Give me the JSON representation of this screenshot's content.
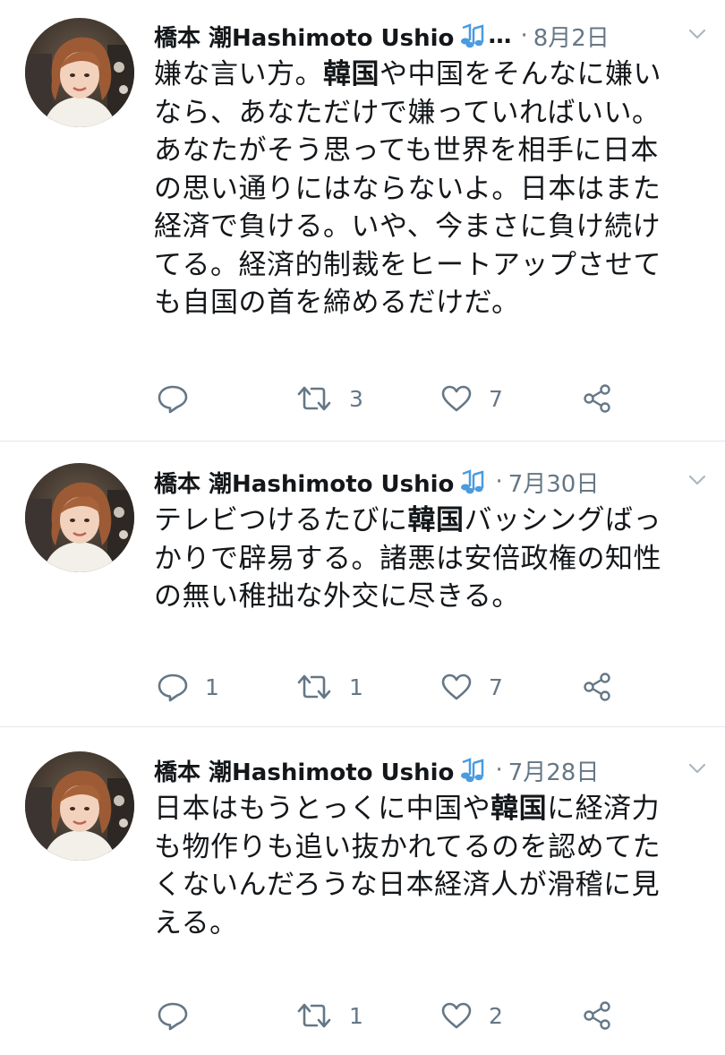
{
  "tweets": [
    {
      "author": "橋本 潮Hashimoto Ushio",
      "truncation": "…",
      "separator": "·",
      "date": "8月2日",
      "text_segments": [
        {
          "t": "嫌な言い方。",
          "bold": false
        },
        {
          "t": "韓国",
          "bold": true
        },
        {
          "t": "や中国をそんなに嫌いなら、あなただけで嫌っていればいい。あなたがそう思っても世界を相手に日本の思い通りにはならないよ。日本はまた経済で負ける。いや、今まさに負け続けてる。経済的制裁をヒートアップさせても自国の首を締めるだけだ。",
          "bold": false
        }
      ],
      "lines": [
        [
          {
            "t": "嫌な言い方。"
          },
          {
            "t": "韓国",
            "b": true
          },
          {
            "t": "や中国をそんなに嫌い"
          }
        ],
        [
          {
            "t": "なら、あなただけで嫌っていればいい。"
          }
        ],
        [
          {
            "t": "あなたがそう思っても世界を相手に日本"
          }
        ],
        [
          {
            "t": "の思い通りにはならないよ。日本はまた"
          }
        ],
        [
          {
            "t": "経済で負ける。いや、今まさに負け続け"
          }
        ],
        [
          {
            "t": "てる。経済的制裁をヒートアップさせて"
          }
        ],
        [
          {
            "t": "も自国の首を締めるだけだ。"
          }
        ]
      ],
      "replies": "",
      "retweets": "3",
      "likes": "7"
    },
    {
      "author": "橋本 潮Hashimoto Ushio",
      "truncation": "",
      "separator": "·",
      "date": "7月30日",
      "lines": [
        [
          {
            "t": "テレビつけるたびに"
          },
          {
            "t": "韓国",
            "b": true
          },
          {
            "t": "バッシングばっ"
          }
        ],
        [
          {
            "t": "かりで辟易する。諸悪は安倍政権の知性"
          }
        ],
        [
          {
            "t": "の無い稚拙な外交に尽きる。"
          }
        ]
      ],
      "replies": "1",
      "retweets": "1",
      "likes": "7"
    },
    {
      "author": "橋本 潮Hashimoto Ushio",
      "truncation": "",
      "separator": "·",
      "date": "7月28日",
      "lines": [
        [
          {
            "t": "日本はもうとっくに中国や"
          },
          {
            "t": "韓国",
            "b": true
          },
          {
            "t": "に経済力"
          }
        ],
        [
          {
            "t": "も物作りも追い抜かれてるのを認めてた"
          }
        ],
        [
          {
            "t": "くないんだろうな日本経済人が滑稽に見"
          }
        ],
        [
          {
            "t": "える。"
          }
        ]
      ],
      "replies": "",
      "retweets": "1",
      "likes": "2"
    }
  ],
  "icons": {
    "reply": "reply-icon",
    "retweet": "retweet-icon",
    "like": "heart-icon",
    "share": "share-icon",
    "menu": "chevron-down-icon",
    "note": "music-note-icon"
  },
  "colors": {
    "text": "#14171a",
    "secondary": "#657786",
    "divider": "#e1e8ed",
    "note": "#4a9be0"
  }
}
